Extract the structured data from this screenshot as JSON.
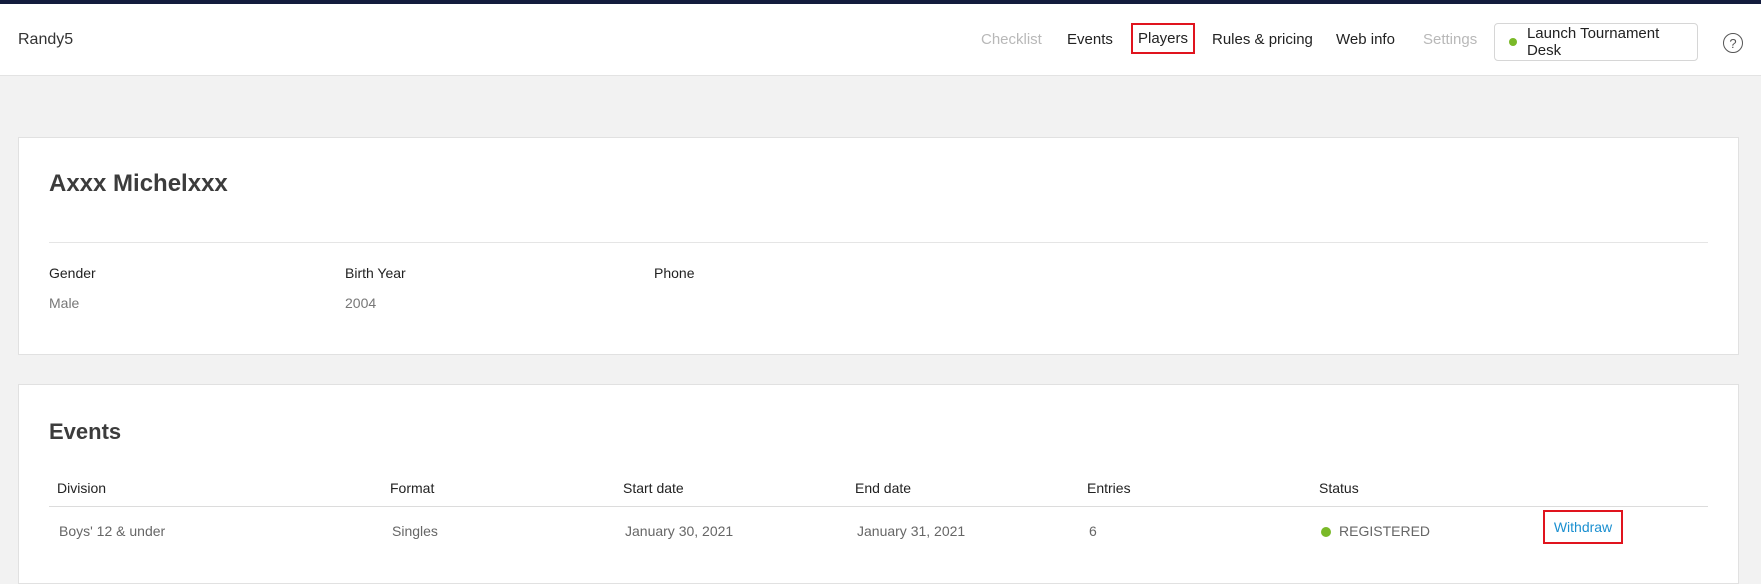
{
  "header": {
    "brand": "Randy5",
    "nav": {
      "checklist": "Checklist",
      "events": "Events",
      "players": "Players",
      "rules": "Rules & pricing",
      "webinfo": "Web info",
      "settings": "Settings"
    },
    "launch_label": "Launch Tournament Desk",
    "help_glyph": "?"
  },
  "player": {
    "name": "Axxx Michelxxx",
    "fields": {
      "gender_label": "Gender",
      "gender_value": "Male",
      "birth_label": "Birth Year",
      "birth_value": "2004",
      "phone_label": "Phone",
      "phone_value": ""
    }
  },
  "events": {
    "title": "Events",
    "columns": {
      "division": "Division",
      "format": "Format",
      "start": "Start date",
      "end": "End date",
      "entries": "Entries",
      "status": "Status"
    },
    "rows": [
      {
        "division": "Boys' 12 & under",
        "format": "Singles",
        "start": "January 30, 2021",
        "end": "January 31, 2021",
        "entries": "6",
        "status": "REGISTERED",
        "action": "Withdraw"
      }
    ]
  },
  "colors": {
    "accent_link": "#1a8fd0",
    "status_green": "#7ab928",
    "highlight_red": "#e0141e",
    "top_bar": "#131c3d"
  },
  "icons": {
    "help": "help-circle-icon",
    "status": "status-dot-icon",
    "launch": "status-dot-icon"
  }
}
